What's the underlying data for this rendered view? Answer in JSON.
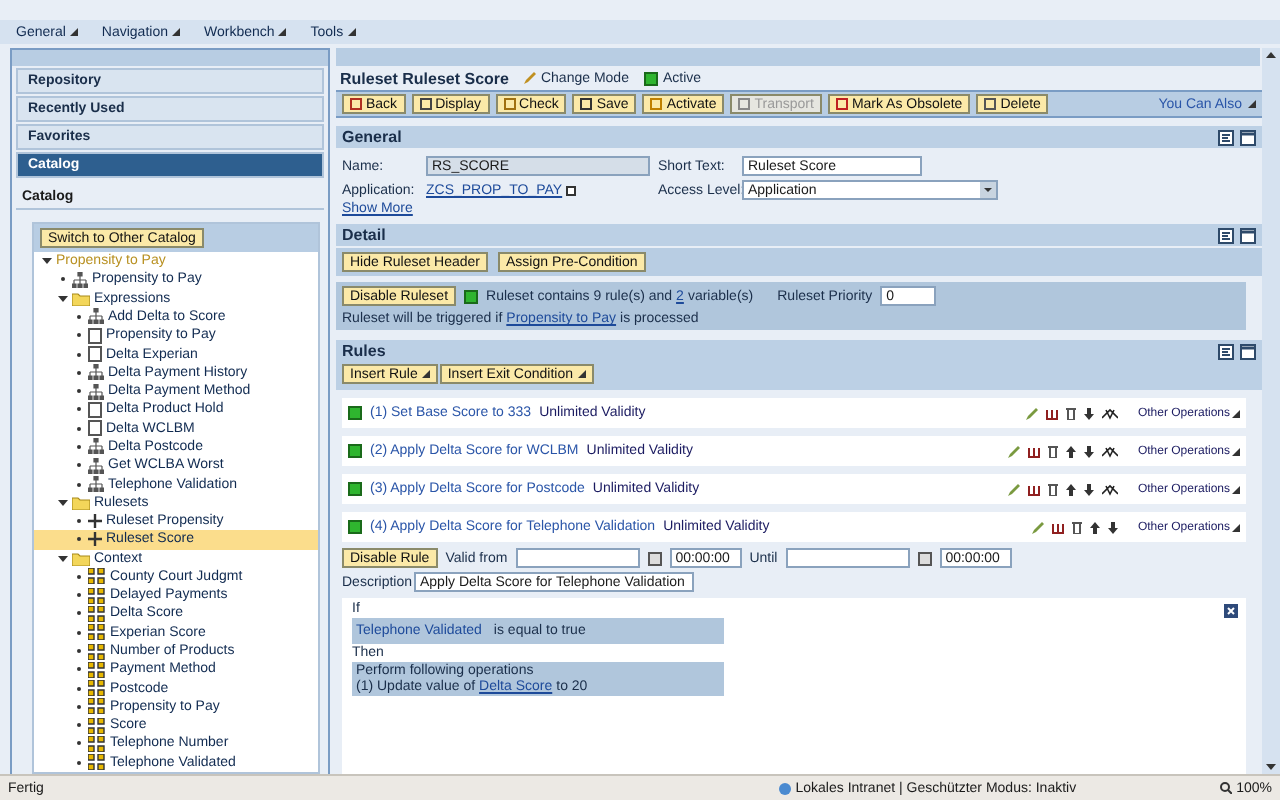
{
  "menu": [
    "General",
    "Navigation",
    "Workbench",
    "Tools"
  ],
  "sidebar": {
    "sections": [
      {
        "label": "Repository",
        "selected": false
      },
      {
        "label": "Recently Used",
        "selected": false
      },
      {
        "label": "Favorites",
        "selected": false
      },
      {
        "label": "Catalog",
        "selected": true
      }
    ],
    "panel_title": "Catalog",
    "switch_button": "Switch to Other Catalog",
    "tree": [
      {
        "label": "Propensity to Pay",
        "kind": "root",
        "expanded": true,
        "selected": false,
        "children": [
          {
            "label": "Propensity to Pay",
            "kind": "structure",
            "selected": false
          },
          {
            "label": "Expressions",
            "kind": "folder",
            "expanded": true,
            "selected": false,
            "children": [
              {
                "label": "Add Delta to Score",
                "kind": "structure",
                "selected": false
              },
              {
                "label": "Propensity to Pay",
                "kind": "box",
                "selected": false
              },
              {
                "label": "Delta Experian",
                "kind": "box",
                "selected": false
              },
              {
                "label": "Delta Payment History",
                "kind": "structure",
                "selected": false
              },
              {
                "label": "Delta Payment Method",
                "kind": "structure",
                "selected": false
              },
              {
                "label": "Delta Product Hold",
                "kind": "box",
                "selected": false
              },
              {
                "label": "Delta WCLBM",
                "kind": "box",
                "selected": false
              },
              {
                "label": "Delta Postcode",
                "kind": "structure",
                "selected": false
              },
              {
                "label": "Get WCLBA Worst",
                "kind": "structure",
                "selected": false
              },
              {
                "label": "Telephone Validation",
                "kind": "structure",
                "selected": false
              }
            ]
          },
          {
            "label": "Rulesets",
            "kind": "folder",
            "expanded": true,
            "selected": false,
            "children": [
              {
                "label": "Ruleset Propensity",
                "kind": "ruleset",
                "selected": false
              },
              {
                "label": "Ruleset Score",
                "kind": "ruleset",
                "selected": true
              }
            ]
          },
          {
            "label": "Context",
            "kind": "folder",
            "expanded": true,
            "selected": false,
            "children": [
              {
                "label": "County Court Judgmt",
                "kind": "element",
                "selected": false
              },
              {
                "label": "Delayed Payments",
                "kind": "element",
                "selected": false
              },
              {
                "label": "Delta Score",
                "kind": "element",
                "selected": false
              },
              {
                "label": "Experian Score",
                "kind": "element",
                "selected": false
              },
              {
                "label": "Number of Products",
                "kind": "element",
                "selected": false
              },
              {
                "label": "Payment Method",
                "kind": "element",
                "selected": false
              },
              {
                "label": "Postcode",
                "kind": "element",
                "selected": false
              },
              {
                "label": "Propensity to Pay",
                "kind": "element",
                "selected": false
              },
              {
                "label": "Score",
                "kind": "element",
                "selected": false
              },
              {
                "label": "Telephone Number",
                "kind": "element",
                "selected": false
              },
              {
                "label": "Telephone Validated",
                "kind": "element",
                "selected": false
              }
            ]
          }
        ]
      }
    ]
  },
  "header": {
    "title": "Ruleset Ruleset Score",
    "mode": "Change Mode",
    "status": "Active"
  },
  "toolbar": [
    {
      "label": "Back",
      "disabled": false
    },
    {
      "label": "Display",
      "disabled": false
    },
    {
      "label": "Check",
      "disabled": false
    },
    {
      "label": "Save",
      "disabled": false
    },
    {
      "label": "Activate",
      "disabled": false
    },
    {
      "label": "Transport",
      "disabled": true
    },
    {
      "label": "Mark As Obsolete",
      "disabled": false
    },
    {
      "label": "Delete",
      "disabled": false
    }
  ],
  "you_can_also": "You Can Also",
  "general": {
    "title": "General",
    "name_label": "Name:",
    "name": "RS_SCORE",
    "application_label": "Application:",
    "application": "ZCS_PROP_TO_PAY",
    "short_text_label": "Short Text:",
    "short_text": "Ruleset Score",
    "access_label": "Access Level:",
    "access": "Application",
    "show_more": "Show More"
  },
  "detail": {
    "title": "Detail",
    "buttons": [
      "Hide Ruleset Header",
      "Assign Pre-Condition"
    ],
    "disable_button": "Disable Ruleset",
    "summary_pre": "Ruleset contains 9 rule(s) and",
    "variables": "2",
    "summary_post": "variable(s)",
    "priority_label": "Ruleset Priority",
    "priority": "0",
    "trigger_pre": "Ruleset will be triggered if",
    "trigger_link": "Propensity to Pay",
    "trigger_post": "is processed"
  },
  "rules": {
    "title": "Rules",
    "buttons": [
      "Insert Rule",
      "Insert Exit Condition"
    ],
    "items": [
      {
        "number": "(1)",
        "text": "Set Base Score to 333",
        "validity": "Unlimited Validity",
        "move_up": false,
        "swap": true,
        "operations": "Other Operations"
      },
      {
        "number": "(2)",
        "text": "Apply Delta Score for WCLBM",
        "validity": "Unlimited Validity",
        "move_up": true,
        "swap": true,
        "operations": "Other Operations"
      },
      {
        "number": "(3)",
        "text": "Apply Delta Score for Postcode",
        "validity": "Unlimited Validity",
        "move_up": true,
        "swap": true,
        "operations": "Other Operations"
      },
      {
        "number": "(4)",
        "text": "Apply Delta Score for Telephone Validation",
        "validity": "Unlimited Validity",
        "move_up": true,
        "swap": false,
        "operations": "Other Operations"
      }
    ],
    "expanded": {
      "disable_button": "Disable Rule",
      "valid_from_label": "Valid from",
      "valid_from_time": "00:00:00",
      "until_label": "Until",
      "until_time": "00:00:00",
      "description_label": "Description",
      "description": "Apply Delta Score for Telephone Validation",
      "if_label": "If",
      "condition_field": "Telephone Validated",
      "condition": "is equal to true",
      "then_label": "Then",
      "perform": "Perform following operations",
      "op_pre": "(1) Update value of",
      "op_link": "Delta Score",
      "op_post": "to 20"
    }
  },
  "status_bar": {
    "left": "Fertig",
    "zone": "Lokales Intranet | Geschützter Modus: Inaktiv",
    "zoom": "100%"
  }
}
